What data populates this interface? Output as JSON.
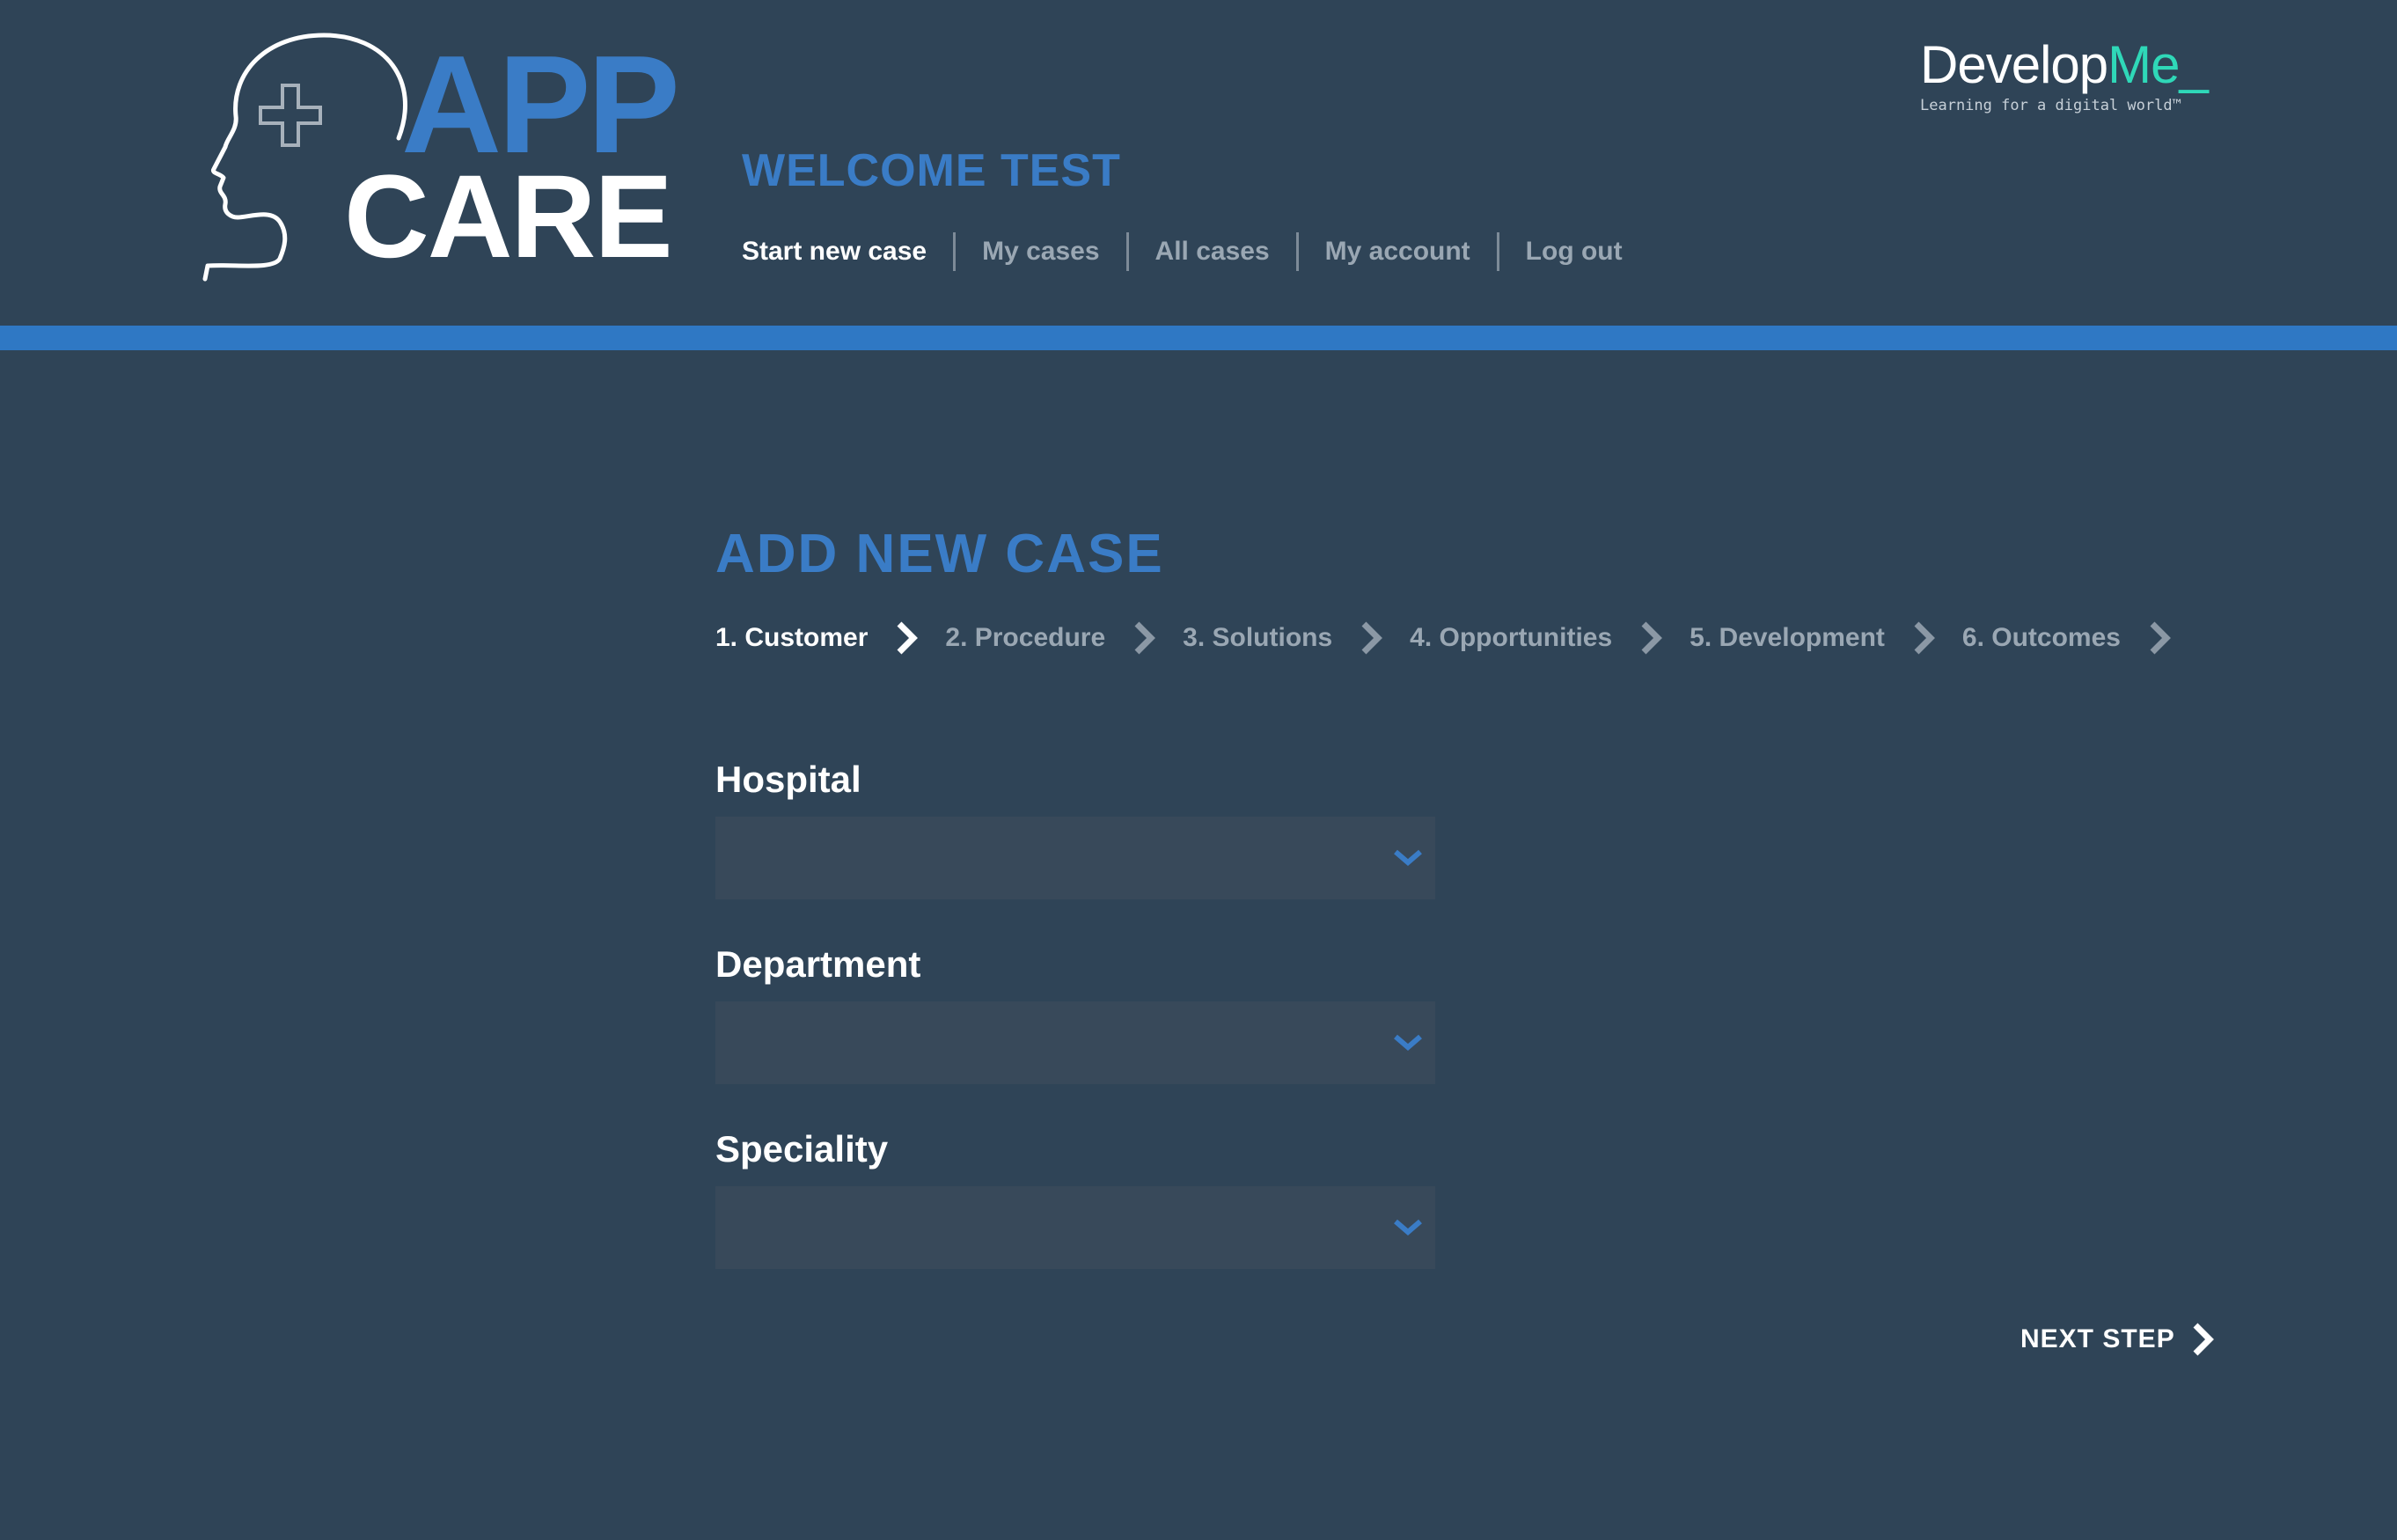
{
  "logo": {
    "line1": "APP",
    "line2": "CARE",
    "icon": "head-with-medical-cross-icon"
  },
  "header": {
    "welcome": "WELCOME TEST",
    "nav": [
      {
        "label": "Start new case",
        "active": true
      },
      {
        "label": "My cases",
        "active": false
      },
      {
        "label": "All cases",
        "active": false
      },
      {
        "label": "My account",
        "active": false
      },
      {
        "label": "Log out",
        "active": false
      }
    ]
  },
  "brand": {
    "name_main": "Develop",
    "name_accent": "Me_",
    "tagline": "Learning for a digital world™",
    "accent_color": "#2fd8b8"
  },
  "main": {
    "title": "ADD NEW CASE",
    "steps": [
      {
        "label": "1. Customer",
        "active": true
      },
      {
        "label": "2. Procedure",
        "active": false
      },
      {
        "label": "3. Solutions",
        "active": false
      },
      {
        "label": "4. Opportunities",
        "active": false
      },
      {
        "label": "5. Development",
        "active": false
      },
      {
        "label": "6. Outcomes",
        "active": false
      }
    ],
    "fields": [
      {
        "label": "Hospital",
        "value": ""
      },
      {
        "label": "Department",
        "value": ""
      },
      {
        "label": "Speciality",
        "value": ""
      }
    ],
    "next_label": "NEXT STEP"
  },
  "colors": {
    "background": "#2f4457",
    "accent_blue": "#3a7cc6",
    "header_bar": "#2f78c4",
    "select_bg": "#38495a"
  }
}
